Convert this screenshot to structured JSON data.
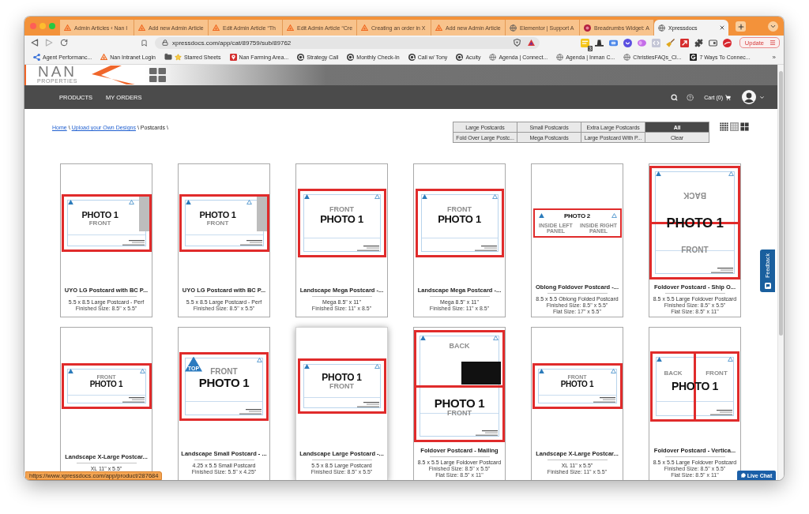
{
  "browser": {
    "tabs": [
      {
        "title": "Admin Articles ‹ Nan I",
        "kind": "triangle",
        "selected": false
      },
      {
        "title": "Add new Admin Article",
        "kind": "triangle",
        "selected": false
      },
      {
        "title": "Edit Admin Article “Th",
        "kind": "triangle",
        "selected": false
      },
      {
        "title": "Edit Admin Article “Cre",
        "kind": "triangle",
        "selected": false
      },
      {
        "title": "Creating an order in X",
        "kind": "triangle",
        "selected": false
      },
      {
        "title": "Add new Admin Article",
        "kind": "triangle",
        "selected": false
      },
      {
        "title": "Elementor | Support A",
        "kind": "globe",
        "selected": false
      },
      {
        "title": "Breadrumbs Widget: A",
        "kind": "dot",
        "selected": false
      },
      {
        "title": "Xpressdocs",
        "kind": "globe",
        "selected": true
      }
    ],
    "address": "xpressdocs.com/app/cat/89759/sub/89762",
    "extension_badge": "3",
    "update_label": "Update",
    "bookmarks": [
      {
        "label": "Agent Performanc...",
        "kind": "network"
      },
      {
        "label": "Nan Intranet Login",
        "kind": "triangle"
      },
      {
        "label": "Starred Sheets",
        "kind": "folder-star"
      },
      {
        "label": "Nan Farming Area...",
        "kind": "pin"
      },
      {
        "label": "Strategy Call",
        "kind": "dial"
      },
      {
        "label": "Monthly Check-In",
        "kind": "dial"
      },
      {
        "label": "Call w/ Tony",
        "kind": "dial"
      },
      {
        "label": "Acuity",
        "kind": "dial"
      },
      {
        "label": "Agenda | Connect...",
        "kind": "globe"
      },
      {
        "label": "Agenda | Inman C...",
        "kind": "globe"
      },
      {
        "label": "ChristiesFAQs_Cl...",
        "kind": "globe"
      },
      {
        "label": "7 Ways To Connec...",
        "kind": "square"
      }
    ],
    "more_bookmarks": "»"
  },
  "site": {
    "logo": {
      "name": "NAN",
      "tagline": "PROPERTIES"
    },
    "nav": [
      "PRODUCTS",
      "MY ORDERS"
    ],
    "cart": "Cart (0)",
    "breadcrumb": [
      {
        "label": "Home",
        "kind": "link"
      },
      {
        "label": "\\",
        "kind": "separator"
      },
      {
        "label": "Upload your Own Designs",
        "kind": "link"
      },
      {
        "label": "\\ Postcards \\",
        "kind": "current"
      }
    ],
    "filters": [
      {
        "label": "Large Postcards",
        "selected": false
      },
      {
        "label": "Small Postcards",
        "selected": false
      },
      {
        "label": "Extra Large Postcards",
        "selected": false
      },
      {
        "label": "All",
        "selected": true
      },
      {
        "label": "Fold Over Large Postc...",
        "selected": false
      },
      {
        "label": "Mega Postcards",
        "selected": false
      },
      {
        "label": "Large Postcard With P...",
        "selected": false
      },
      {
        "label": "Clear",
        "selected": false
      }
    ],
    "view_options": [
      {
        "kind": "grid-small",
        "selected": false
      },
      {
        "kind": "grid-medium",
        "selected": true
      },
      {
        "kind": "grid-large",
        "selected": false
      }
    ],
    "products": [
      {
        "title": "UYO LG Postcard with BC P...",
        "subtitle": "5.5 x 8.5 Large Postcard - Perf",
        "specs": [
          "Finished Size: 8.5\" x 5.5\""
        ],
        "hovered": false,
        "thumbnail": {
          "kind": "landscape-bc",
          "panels": [
            {
              "texts": [
                {
                  "text": "PHOTO 1",
                  "kind": "heading"
                },
                {
                  "text": "FRONT",
                  "kind": "caption"
                }
              ]
            }
          ]
        }
      },
      {
        "title": "UYO LG Postcard with BC P...",
        "subtitle": "5.5 x 8.5 Large Postcard - Perf",
        "specs": [
          "Finished Size: 8.5\" x 5.5\""
        ],
        "hovered": false,
        "thumbnail": {
          "kind": "landscape-bc",
          "panels": [
            {
              "texts": [
                {
                  "text": "PHOTO 1",
                  "kind": "heading"
                },
                {
                  "text": "FRONT",
                  "kind": "caption"
                }
              ]
            }
          ]
        }
      },
      {
        "title": "Landscape Mega Postcard -...",
        "subtitle": "Mega 8.5\" x 11\"",
        "specs": [
          "Finished Size: 11\" x 8.5\""
        ],
        "hovered": false,
        "thumbnail": {
          "kind": "landscape-mega",
          "panels": [
            {
              "texts": [
                {
                  "text": "FRONT",
                  "kind": "caption"
                },
                {
                  "text": "PHOTO 1",
                  "kind": "heading"
                }
              ]
            }
          ]
        }
      },
      {
        "title": "Landscape Mega Postcard -...",
        "subtitle": "Mega 8.5\" x 11\"",
        "specs": [
          "Finished Size: 11\" x 8.5\""
        ],
        "hovered": false,
        "thumbnail": {
          "kind": "landscape-mega",
          "panels": [
            {
              "texts": [
                {
                  "text": "FRONT",
                  "kind": "caption"
                },
                {
                  "text": "PHOTO 1",
                  "kind": "heading"
                }
              ]
            }
          ]
        }
      },
      {
        "title": "Oblong Foldover Postcard -...",
        "subtitle": "8.5 x 5.5 Oblong Folded Postcard",
        "specs": [
          "Finished Size: 8.5\" x 5.5\"",
          "Flat Size: 17\" x 5.5\""
        ],
        "hovered": false,
        "thumbnail": {
          "kind": "oblong-fold",
          "panels": [
            {
              "texts": [
                {
                  "text": "PHOTO 2",
                  "kind": "spanning"
                },
                {
                  "text": "INSIDE LEFT PANEL",
                  "kind": "label"
                }
              ]
            },
            {
              "texts": [
                {
                  "text": "INSIDE RIGHT PANEL",
                  "kind": "label"
                }
              ]
            }
          ]
        }
      },
      {
        "title": "Foldover Postcard - Ship O...",
        "subtitle": "8.5 x 5.5 Large Foldover Postcard",
        "specs": [
          "Finished Size: 8.5\" x 5.5\"",
          "Flat Size: 8.5\" x 11\""
        ],
        "hovered": false,
        "thumbnail": {
          "kind": "top-fold-ship",
          "panels": [
            {
              "texts": [
                {
                  "text": "BACK",
                  "kind": "flipped"
                }
              ]
            },
            {
              "texts": [
                {
                  "text": "PHOTO 1",
                  "kind": "spanning"
                },
                {
                  "text": "FRONT",
                  "kind": "caption"
                }
              ]
            }
          ]
        }
      },
      {
        "title": "Landscape X-Large Postcar...",
        "subtitle": "XL 11\" x 5.5\"",
        "hovered": false,
        "thumbnail": {
          "kind": "landscape-xl",
          "panels": [
            {
              "texts": [
                {
                  "text": "FRONT",
                  "kind": "caption"
                },
                {
                  "text": "PHOTO 1",
                  "kind": "heading"
                }
              ]
            }
          ]
        }
      },
      {
        "title": "Landscape Small Postcard - ...",
        "subtitle": "4.25 x 5.5 Small Postcard",
        "specs": [
          "Finished Size: 5.5\" x 4.25\""
        ],
        "hovered": false,
        "thumbnail": {
          "kind": "landscape-small",
          "badge": "TOP",
          "panels": [
            {
              "texts": [
                {
                  "text": "FRONT",
                  "kind": "caption"
                },
                {
                  "text": "PHOTO 1",
                  "kind": "heading"
                }
              ]
            }
          ]
        }
      },
      {
        "title": "Landscape Large Postcard -...",
        "subtitle": "5.5 x 8.5 Large Postcard",
        "specs": [
          "Finished Size: 8.5\" x 5.5\""
        ],
        "hovered": true,
        "thumbnail": {
          "kind": "landscape-large",
          "panels": [
            {
              "texts": [
                {
                  "text": "PHOTO 1",
                  "kind": "heading"
                },
                {
                  "text": "FRONT",
                  "kind": "caption"
                }
              ]
            }
          ]
        }
      },
      {
        "title": "Foldover Postcard - Mailing",
        "subtitle": "8.5 x 5.5 Large Foldover Postcard",
        "specs": [
          "Finished Size: 8.5\" x 5.5\"",
          "Flat Size: 8.5\" x 11\""
        ],
        "hovered": false,
        "thumbnail": {
          "kind": "top-fold-mailing",
          "panels": [
            {
              "texts": [
                {
                  "text": "BACK",
                  "kind": "caption"
                }
              ]
            },
            {
              "texts": [
                {
                  "text": "PHOTO 1",
                  "kind": "heading"
                },
                {
                  "text": "FRONT",
                  "kind": "caption"
                }
              ]
            }
          ]
        }
      },
      {
        "title": "Landscape X-Large Postcar...",
        "subtitle": "XL 11\" x 5.5\"",
        "specs": [
          "Finished Size: 11\" x 5.5\""
        ],
        "hovered": false,
        "thumbnail": {
          "kind": "landscape-xl",
          "panels": [
            {
              "texts": [
                {
                  "text": "FRONT",
                  "kind": "caption"
                },
                {
                  "text": "PHOTO 1",
                  "kind": "heading"
                }
              ]
            }
          ]
        }
      },
      {
        "title": "Foldover Postcard - Vertica...",
        "subtitle": "8.5 x 5.5 Large Foldover Postcard",
        "specs": [
          "Finished Size: 8.5\" x 5.5\"",
          "Flat Size: 8.5\" x 11\""
        ],
        "hovered": false,
        "thumbnail": {
          "kind": "side-fold",
          "panels": [
            {
              "texts": [
                {
                  "text": "BACK",
                  "kind": "caption"
                }
              ]
            },
            {
              "texts": [
                {
                  "text": "FRONT",
                  "kind": "caption"
                },
                {
                  "text": "PHOTO 1",
                  "kind": "spanning"
                }
              ]
            }
          ]
        }
      }
    ]
  },
  "feedback_tab": "Feedback",
  "live_chat": "Live Chat",
  "status_url": "https://www.xpressdocs.com/app/product/287684"
}
